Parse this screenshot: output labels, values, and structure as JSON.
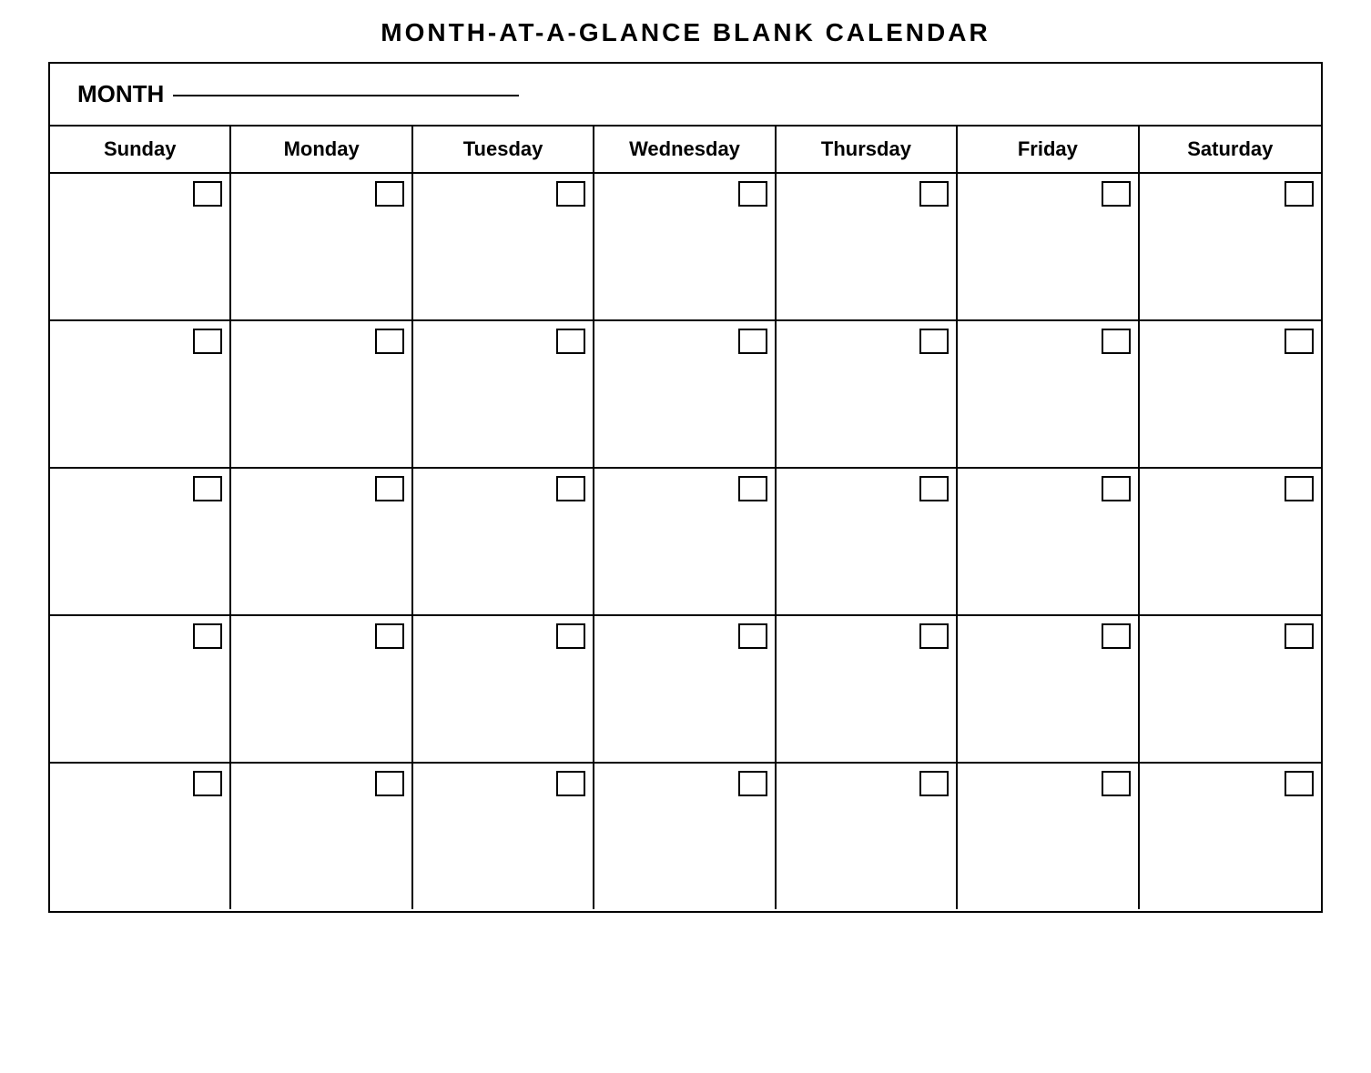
{
  "title": "MONTH-AT-A-GLANCE  BLANK  CALENDAR",
  "month_label": "MONTH",
  "days": [
    {
      "label": "Sunday"
    },
    {
      "label": "Monday"
    },
    {
      "label": "Tuesday"
    },
    {
      "label": "Wednesday"
    },
    {
      "label": "Thursday"
    },
    {
      "label": "Friday"
    },
    {
      "label": "Saturday"
    }
  ],
  "rows": 5,
  "cols": 7
}
